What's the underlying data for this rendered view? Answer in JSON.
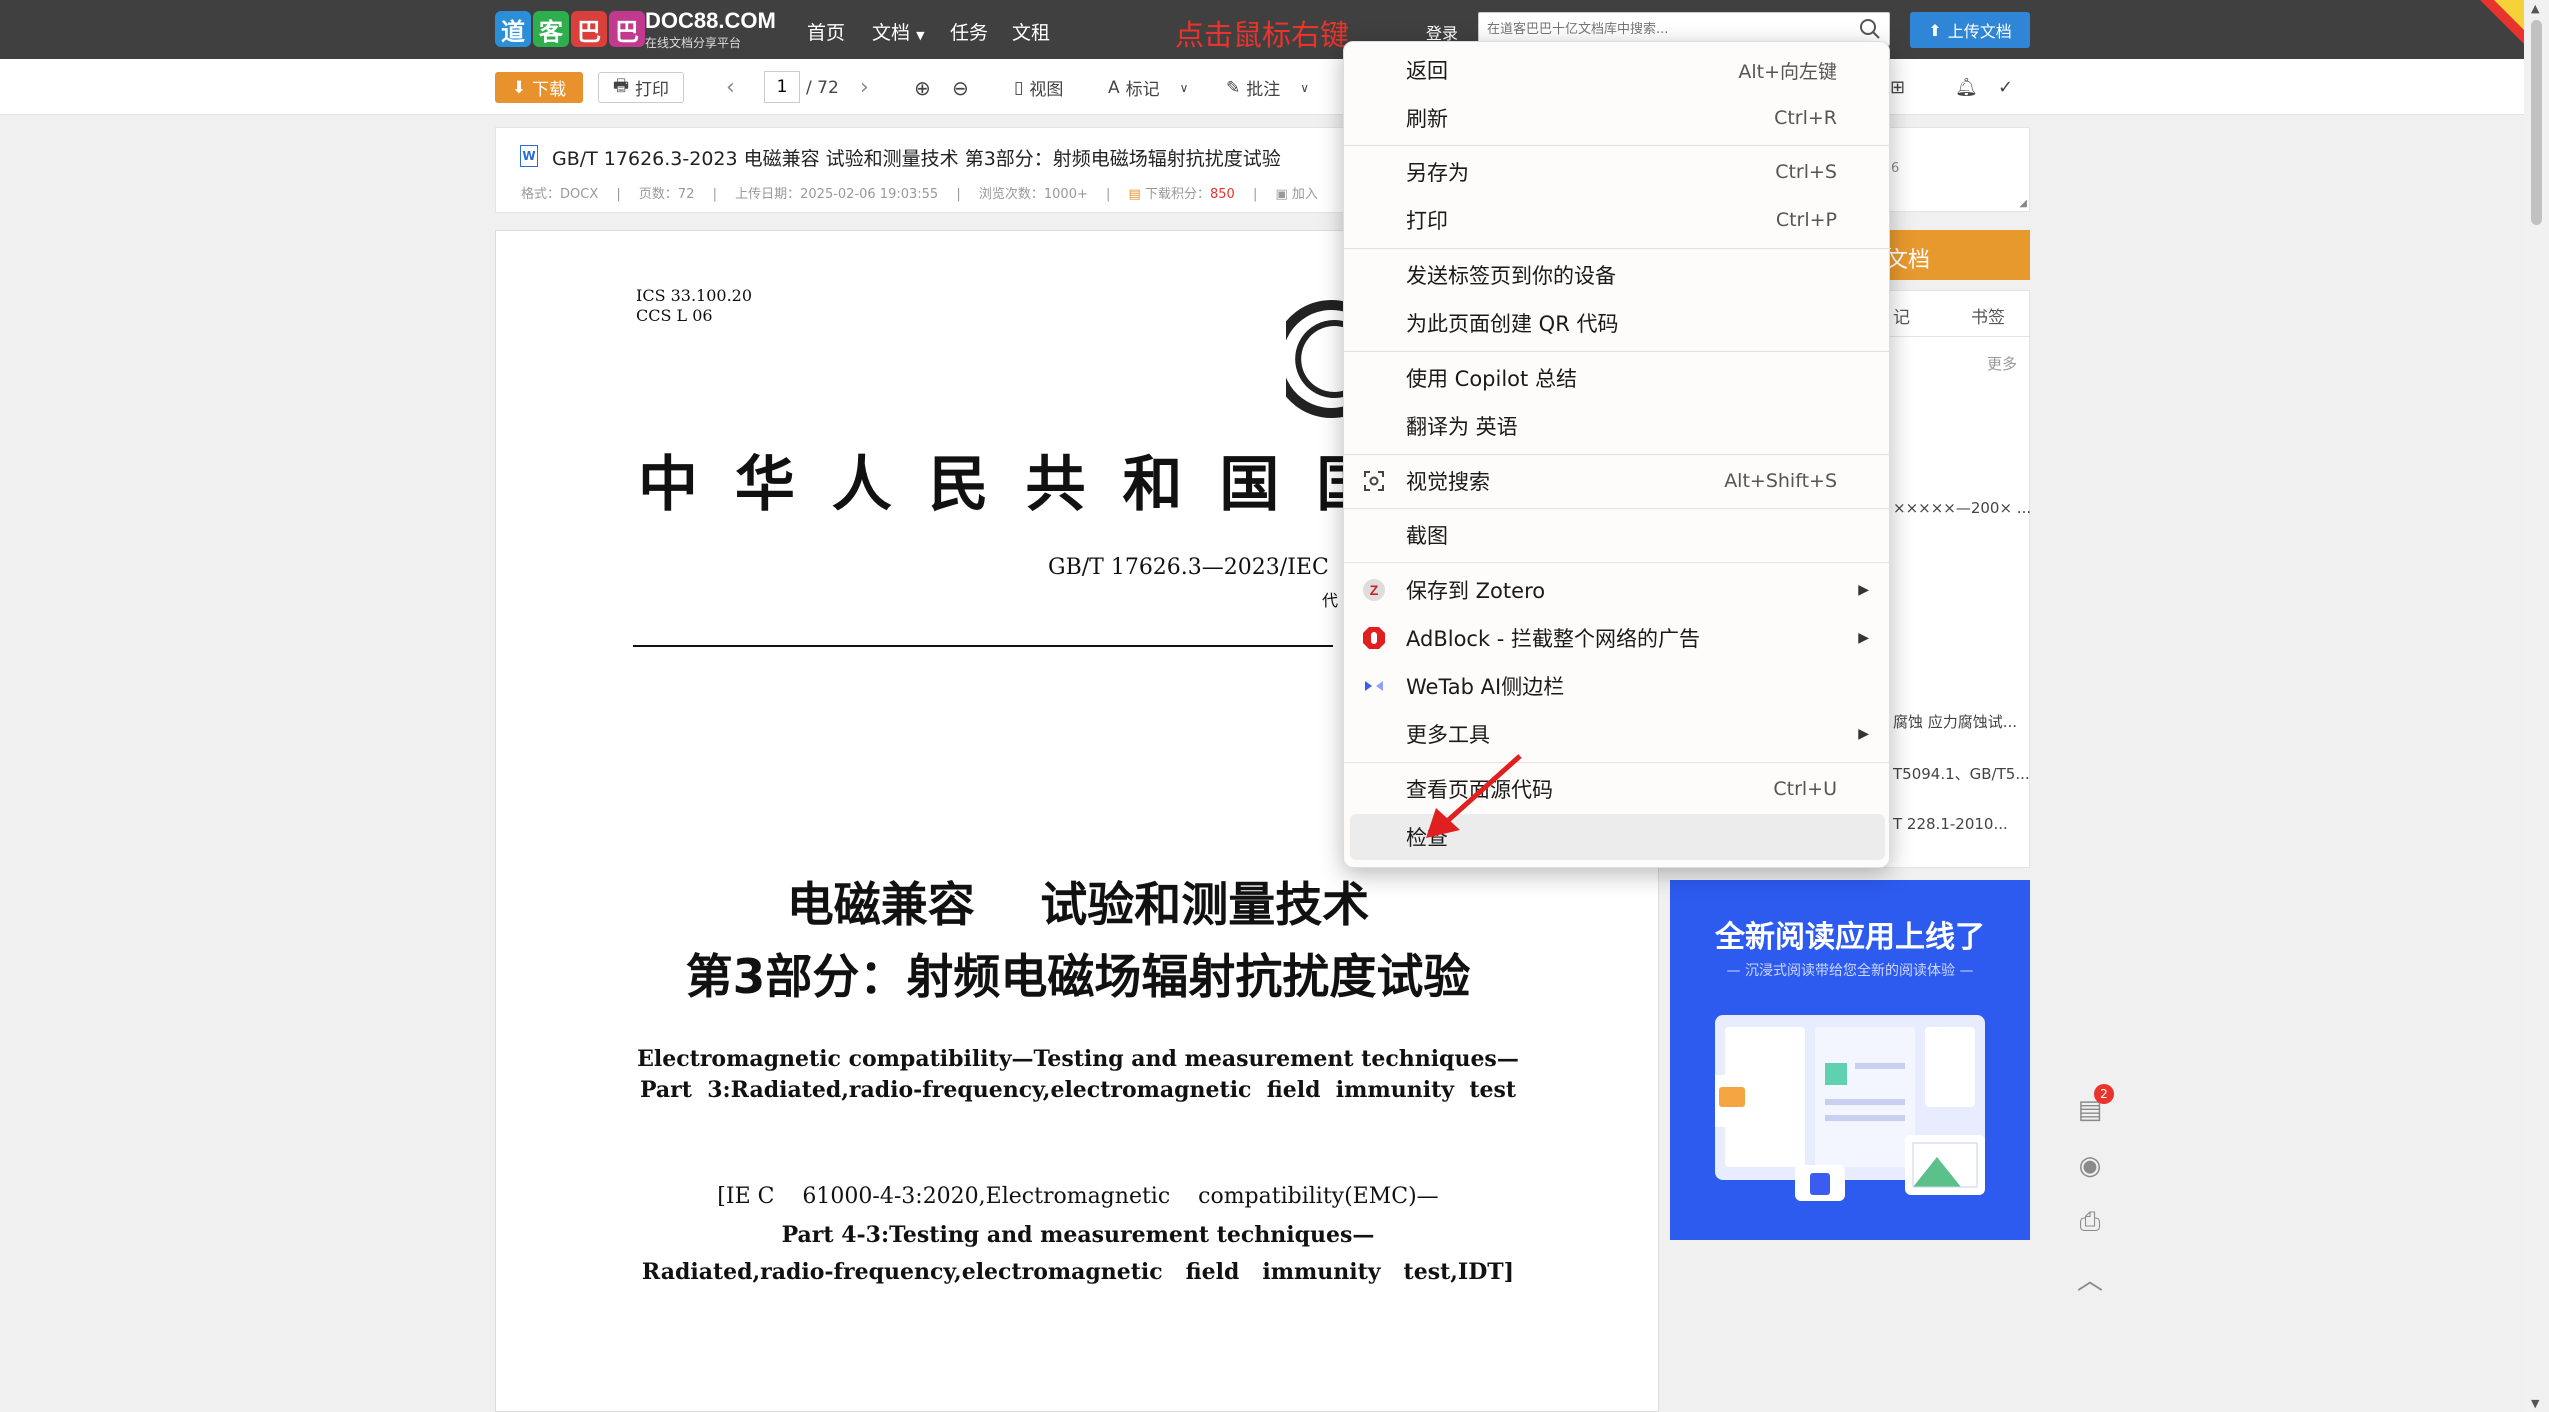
{
  "header": {
    "logo_chars": [
      "道",
      "客",
      "巴",
      "巴"
    ],
    "logo_colors": [
      "#2b8fd8",
      "#2fae4e",
      "#d9403b",
      "#c23a8e"
    ],
    "site_domain": "DOC88.COM",
    "site_tagline": "在线文档分享平台",
    "nav": [
      "首页",
      "文档",
      "任务",
      "文租"
    ],
    "annotation": "点击鼠标右键",
    "login": "登录",
    "search_placeholder": "在道客巴巴十亿文档库中搜索...",
    "upload_label": "上传文档"
  },
  "toolbar": {
    "download": "下载",
    "print": "打印",
    "page_current": "1",
    "page_total": "/ 72",
    "view": "视图",
    "mark": "标记",
    "annotate": "批注"
  },
  "docinfo": {
    "title": "GB/T 17626.3-2023 电磁兼容 试验和测量技术 第3部分：射频电磁场辐射抗扰度试验",
    "format": "格式：DOCX",
    "pages": "页数：72",
    "upload_date": "上传日期：2025-02-06 19:03:55",
    "views": "浏览次数：1000+",
    "points_label": "下载积分：",
    "points_value": "850",
    "add": "加入"
  },
  "document": {
    "ics": "ICS  33.100.20",
    "ccs": "CCS  L  06",
    "national_title": "中 华 人 民 共 和 国 国",
    "std_number": "GB/T  17626.3—2023/IEC",
    "replace": "代",
    "cn_title_1": "电磁兼容    试验和测量技术",
    "cn_title_2": "第3部分：射频电磁场辐射抗扰度试验",
    "en_title_1": "Electromagnetic compatibility—Testing and measurement techniques—",
    "en_title_2": "Part  3:Radiated,radio-frequency,electromagnetic  field  immunity  test",
    "iec_1": "[IE C    61000-4-3:2020,Electromagnetic    compatibility(EMC)—",
    "iec_2": "Part 4-3:Testing and measurement techniques—",
    "iec_3": "Radiated,radio-frequency,electromagnetic   field   immunity   test,IDT]"
  },
  "sidebar": {
    "top_fragment": "6",
    "orange_label": "文档",
    "tab_notes": "记",
    "tab_bookmark": "书签",
    "more": "更多",
    "related_1": "×××××—200× ...",
    "related_2": "腐蚀 应力腐蚀试...",
    "related_3": "T5094.1、GB/T5...",
    "related_4": "T 228.1-2010..."
  },
  "ad": {
    "title": "全新阅读应用上线了",
    "subtitle": "— 沉浸式阅读带给您全新的阅读体验 —"
  },
  "float_tools": {
    "badge_count": "2"
  },
  "context_menu": {
    "items": [
      {
        "label": "返回",
        "shortcut": "Alt+向左键"
      },
      {
        "label": "刷新",
        "shortcut": "Ctrl+R"
      },
      {
        "label": "另存为",
        "shortcut": "Ctrl+S"
      },
      {
        "label": "打印",
        "shortcut": "Ctrl+P"
      },
      {
        "label": "发送标签页到你的设备",
        "shortcut": ""
      },
      {
        "label": "为此页面创建 QR 代码",
        "shortcut": ""
      },
      {
        "label": "使用 Copilot 总结",
        "shortcut": ""
      },
      {
        "label": "翻译为 英语",
        "shortcut": ""
      },
      {
        "label": "视觉搜索",
        "shortcut": "Alt+Shift+S"
      },
      {
        "label": "截图",
        "shortcut": ""
      },
      {
        "label": "保存到 Zotero",
        "shortcut": ""
      },
      {
        "label": "AdBlock - 拦截整个网络的广告",
        "shortcut": ""
      },
      {
        "label": "WeTab AI侧边栏",
        "shortcut": ""
      },
      {
        "label": "更多工具",
        "shortcut": ""
      },
      {
        "label": "查看页面源代码",
        "shortcut": "Ctrl+U"
      },
      {
        "label": "检查",
        "shortcut": ""
      }
    ],
    "highlight_color": "#ececec",
    "arrow_color": "#e02020"
  }
}
